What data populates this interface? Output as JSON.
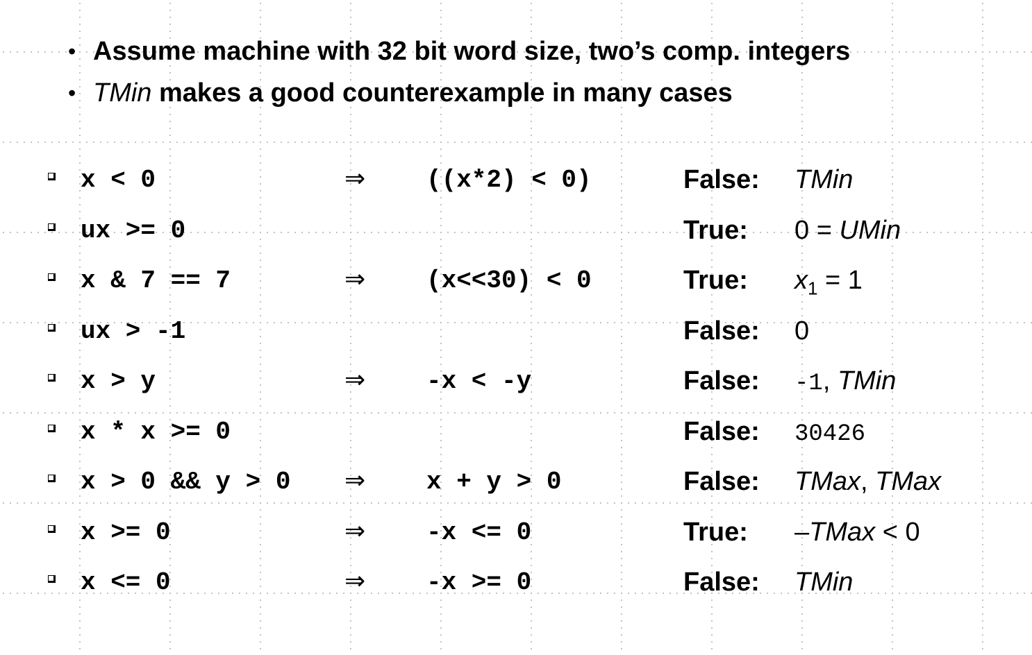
{
  "bullets": [
    {
      "text": "Assume machine with 32 bit word size, two’s comp. integers"
    },
    {
      "italic": "TMin",
      "text": " makes a good counterexample in many cases"
    }
  ],
  "bullet_glyph": "•",
  "arrow_glyph": "⇒",
  "rows": [
    {
      "lhs": "x < 0",
      "rhs": "((x*2) < 0)",
      "verdict": "False:",
      "example": [
        {
          "t": "TMin",
          "s": "it"
        }
      ]
    },
    {
      "lhs": "ux >= 0",
      "rhs": "",
      "verdict": "True:",
      "example": [
        {
          "t": "0 = ",
          "s": ""
        },
        {
          "t": "UMin",
          "s": "it"
        }
      ]
    },
    {
      "lhs": "x & 7 == 7",
      "rhs": "(x<<30) < 0",
      "verdict": "True:",
      "example": [
        {
          "t": "x",
          "s": "it"
        },
        {
          "t": "1",
          "s": "sub"
        },
        {
          "t": " = 1",
          "s": ""
        }
      ]
    },
    {
      "lhs": "ux > -1",
      "rhs": "",
      "verdict": "False:",
      "example": [
        {
          "t": "0",
          "s": ""
        }
      ]
    },
    {
      "lhs": "x > y",
      "rhs": "-x < -y",
      "verdict": "False:",
      "example": [
        {
          "t": "-1",
          "s": "mono"
        },
        {
          "t": ", ",
          "s": ""
        },
        {
          "t": "TMin",
          "s": "it"
        }
      ]
    },
    {
      "lhs": "x * x >= 0",
      "rhs": "",
      "verdict": "False:",
      "example": [
        {
          "t": "30426",
          "s": "mono"
        }
      ]
    },
    {
      "lhs": "x > 0 && y > 0",
      "rhs": "x + y > 0",
      "verdict": "False:",
      "example": [
        {
          "t": "TMax",
          "s": "it"
        },
        {
          "t": ", ",
          "s": ""
        },
        {
          "t": "TMax",
          "s": "it"
        }
      ]
    },
    {
      "lhs": "x >= 0",
      "rhs": "-x <= 0",
      "verdict": "True:",
      "example": [
        {
          "t": "–",
          "s": ""
        },
        {
          "t": "TMax",
          "s": "it"
        },
        {
          "t": " < 0",
          "s": ""
        }
      ]
    },
    {
      "lhs": "x <= 0",
      "rhs": "-x >= 0",
      "verdict": "False:",
      "example": [
        {
          "t": "TMin",
          "s": "it"
        }
      ]
    }
  ]
}
